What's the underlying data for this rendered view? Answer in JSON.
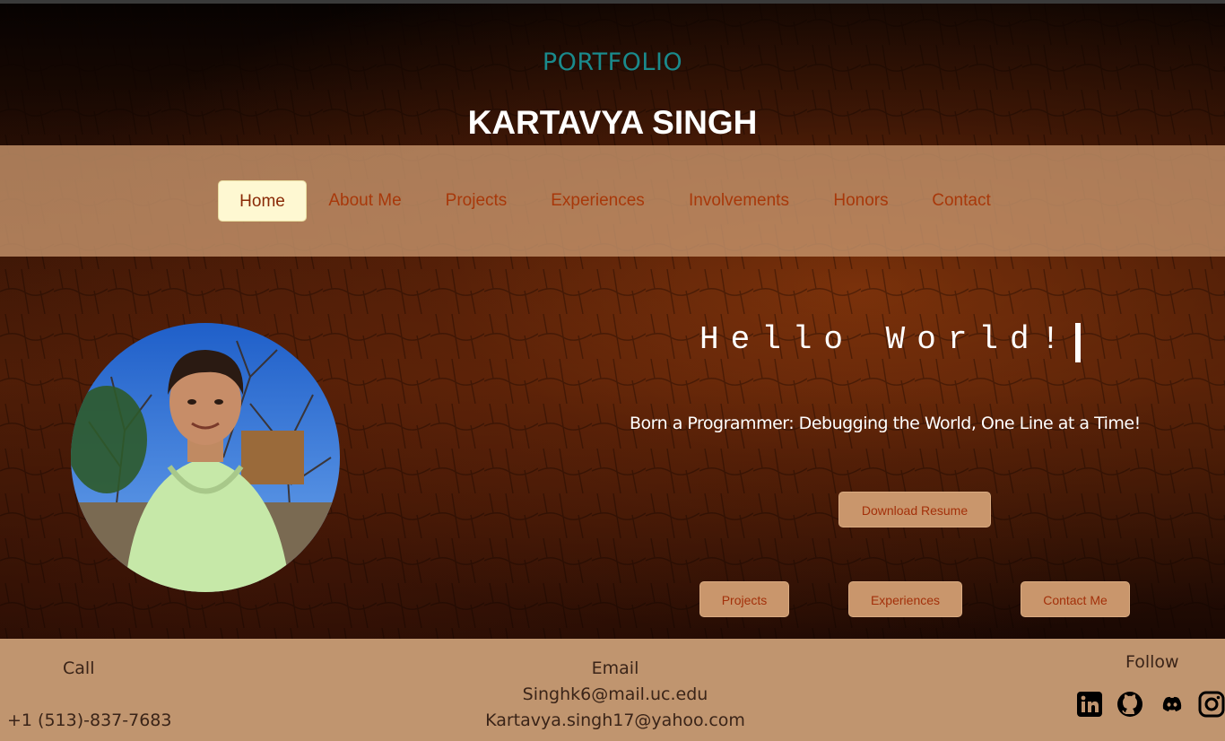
{
  "header": {
    "portfolio_label": "PORTFOLIO",
    "name": "KARTAVYA SINGH"
  },
  "nav": {
    "items": [
      {
        "label": "Home",
        "active": true
      },
      {
        "label": "About Me"
      },
      {
        "label": "Projects"
      },
      {
        "label": "Experiences"
      },
      {
        "label": "Involvements"
      },
      {
        "label": "Honors"
      },
      {
        "label": "Contact"
      }
    ]
  },
  "hero": {
    "greeting": "Hello World!",
    "tagline": "Born a Programmer: Debugging the World, One Line at a Time!",
    "download_resume": "Download Resume",
    "projects_btn": "Projects",
    "experiences_btn": "Experiences",
    "contact_btn": "Contact Me"
  },
  "footer": {
    "call_label": "Call",
    "phone": "+1 (513)-837-7683",
    "email_label": "Email",
    "email_1": "Singhk6@mail.uc.edu",
    "email_2": "Kartavya.singh17@yahoo.com",
    "follow_label": "Follow",
    "social_icons": [
      "linkedin-icon",
      "github-icon",
      "discord-icon",
      "instagram-icon"
    ]
  },
  "colors": {
    "nav_text": "#a8380a",
    "active_nav_bg": "#fef8d2",
    "button_bg": "#c9966c",
    "footer_bg": "#c0956f",
    "portfolio_accent": "#1a8a8c"
  }
}
